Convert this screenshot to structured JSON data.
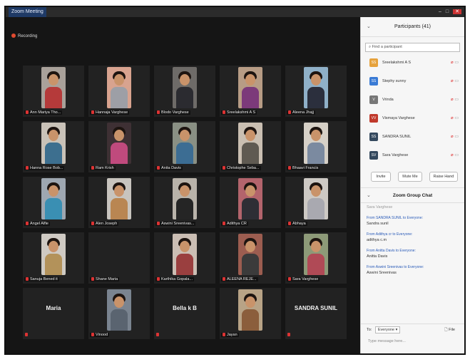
{
  "window": {
    "title": "Zoom Meeting",
    "recording_label": "Recording"
  },
  "tiles": [
    {
      "name": "Ann Mariya Tho...",
      "kind": "video",
      "bg": "#a9a19a",
      "shirt": "#b53a3a"
    },
    {
      "name": "Hannaja Varghese",
      "kind": "video",
      "bg": "#d8a38f",
      "shirt": "#9d9fa6"
    },
    {
      "name": "Blodo Varghese",
      "kind": "video",
      "bg": "#6e6b68",
      "shirt": "#2b2b30"
    },
    {
      "name": "Sreelakshmi A S",
      "kind": "video",
      "bg": "#b79c85",
      "shirt": "#7c3a7a"
    },
    {
      "name": "Aleena Jhajj",
      "kind": "video",
      "bg": "#8fb0c8",
      "shirt": "#2b2f3d"
    },
    {
      "name": "Hanna Rose Bob...",
      "kind": "video",
      "bg": "#c9c2b8",
      "shirt": "#3d6f8f"
    },
    {
      "name": "Ram Krish",
      "kind": "video",
      "bg": "#3e3034",
      "shirt": "#c04a7d"
    },
    {
      "name": "Anita Davis",
      "kind": "video",
      "bg": "#8a9084",
      "shirt": "#3c6d93"
    },
    {
      "name": "Christophe Seba...",
      "kind": "video",
      "bg": "#cabfb2",
      "shirt": "#5f5a52"
    },
    {
      "name": "Bhaavi Francis",
      "kind": "video",
      "bg": "#d6d0c7",
      "shirt": "#7b8aa0"
    },
    {
      "name": "Angel Alfie",
      "kind": "video",
      "bg": "#9ea7b1",
      "shirt": "#3a8fb3"
    },
    {
      "name": "Alen Joseph",
      "kind": "video",
      "bg": "#c8c4be",
      "shirt": "#b98652"
    },
    {
      "name": "Aswini Sreenivas...",
      "kind": "video",
      "bg": "#b9b3aa",
      "shirt": "#252525"
    },
    {
      "name": "Adithya CR",
      "kind": "video",
      "bg": "#b3646c",
      "shirt": "#2e2e35"
    },
    {
      "name": "Abhaya",
      "kind": "video",
      "bg": "#cdc9c4",
      "shirt": "#a9a9b0"
    },
    {
      "name": "Sanuja Bened it",
      "kind": "video",
      "bg": "#cfcac3",
      "shirt": "#b3925a"
    },
    {
      "name": "Shane Maria",
      "kind": "empty",
      "label": ""
    },
    {
      "name": "Karthika Gopala...",
      "kind": "video",
      "bg": "#cbbeb4",
      "shirt": "#9a3f3f"
    },
    {
      "name": "ALEENA REJE...",
      "kind": "video",
      "bg": "#9c5d50",
      "shirt": "#3b3b3b"
    },
    {
      "name": "Sara Varghese",
      "kind": "video",
      "bg": "#8d9a78",
      "shirt": "#b04a56"
    },
    {
      "name": "",
      "kind": "label",
      "label": "Maria"
    },
    {
      "name": "Vinood",
      "kind": "video",
      "bg": "#7a8490",
      "shirt": "#5a6470"
    },
    {
      "name": "",
      "kind": "label",
      "label": "Bella k B"
    },
    {
      "name": "Jayan",
      "kind": "video",
      "bg": "#b8a386",
      "shirt": "#8b5e3c"
    },
    {
      "name": "",
      "kind": "label",
      "label": "SANDRA SUNIL"
    }
  ],
  "participants": {
    "header": "Participants (41)",
    "search_placeholder": "Find a participant",
    "list": [
      {
        "initials": "SS",
        "color": "#e6a23c",
        "name": "Sreelakshmi A S"
      },
      {
        "initials": "SS",
        "color": "#3a7bd5",
        "name": "Stephy sunny"
      },
      {
        "initials": "V",
        "color": "#777777",
        "name": "Vrinda"
      },
      {
        "initials": "VV",
        "color": "#c0392b",
        "name": "Vismaya Varghese"
      },
      {
        "initials": "SS",
        "color": "#34495e",
        "name": "SANDRA SUNIL"
      },
      {
        "initials": "SV",
        "color": "#34495e",
        "name": "Sara Varghese"
      }
    ],
    "buttons": {
      "invite": "Invite",
      "mute_me": "Mute Me",
      "raise_hand": "Raise Hand"
    }
  },
  "chat": {
    "header": "Zoom Group Chat",
    "top_text": "Sara Varghese",
    "messages": [
      {
        "from": "From SANDRA SUNIL to Everyone:",
        "text": "Sandra sunil"
      },
      {
        "from": "From Adithya cr to Everyone:",
        "text": "adithya c.m"
      },
      {
        "from": "From Anitta Davis to Everyone:",
        "text": "Anitta Davis"
      },
      {
        "from": "From Aswini Sreenivas to Everyone:",
        "text": "Aswini Sreenivas"
      }
    ],
    "to_label": "To:",
    "to_value": "Everyone",
    "file_label": "File",
    "input_placeholder": "Type message here..."
  }
}
